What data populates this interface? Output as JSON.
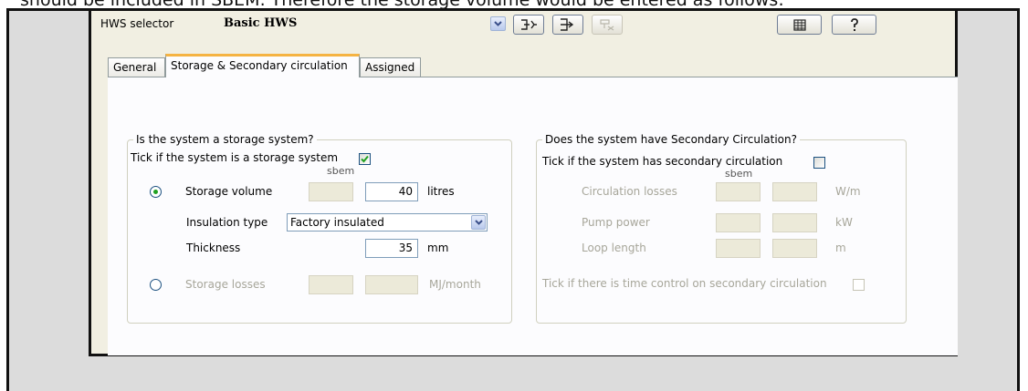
{
  "document": {
    "text": "should be included in SBEM. Therefore the storage volume would be entered as follows:"
  },
  "toolbar": {
    "selector_label": "HWS selector",
    "selected_hws": "Basic HWS"
  },
  "tabs": [
    {
      "label": "General"
    },
    {
      "label": "Storage & Secondary circulation"
    },
    {
      "label": "Assigned"
    }
  ],
  "storage": {
    "group_title": "Is the system a storage system?",
    "tick_label": "Tick if the system is a storage system",
    "tick_checked": true,
    "sbem_header": "sbem",
    "volume_label": "Storage volume",
    "volume_value": "40",
    "volume_unit": "litres",
    "insulation_label": "Insulation type",
    "insulation_value": "Factory insulated",
    "thickness_label": "Thickness",
    "thickness_value": "35",
    "thickness_unit": "mm",
    "losses_label": "Storage losses",
    "losses_unit": "MJ/month"
  },
  "secondary": {
    "group_title": "Does the system have Secondary Circulation?",
    "tick_label": "Tick if the system has secondary circulation",
    "tick_checked": false,
    "sbem_header": "sbem",
    "circulation_losses_label": "Circulation losses",
    "circulation_losses_unit": "W/m",
    "pump_power_label": "Pump power",
    "pump_power_unit": "kW",
    "loop_length_label": "Loop length",
    "loop_length_unit": "m",
    "time_control_label": "Tick if there is time control on secondary circulation"
  },
  "colors": {
    "window_bg": "#f1efe2",
    "tab_accent": "#f5b342",
    "check_green": "#21a121"
  }
}
